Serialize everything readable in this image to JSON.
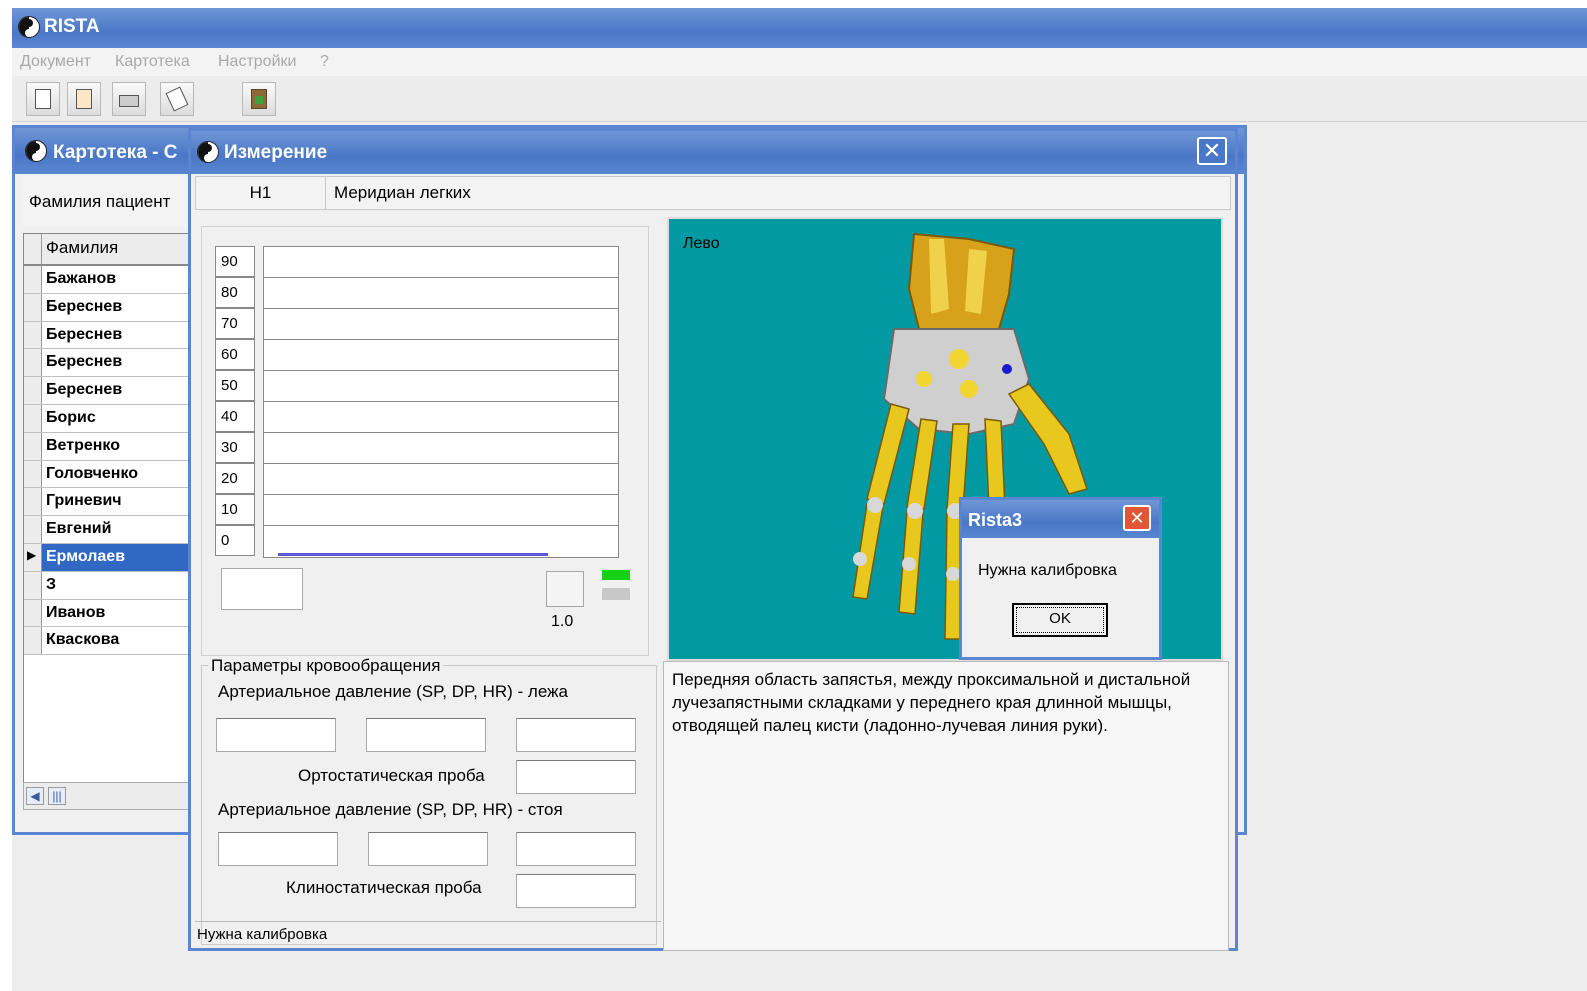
{
  "app": {
    "title": "RISTA"
  },
  "menu": [
    "Документ",
    "Картотека",
    "Настройки",
    "?"
  ],
  "toolbar": {
    "buttons": [
      "new-document-icon",
      "open-document-icon",
      "print-icon",
      "copy-document-icon",
      "exit-icon"
    ]
  },
  "kartoteka": {
    "title": "Картотека - С",
    "filter_label": "Фамилия пациент",
    "column_header": "Фамилия",
    "patients": [
      "Бажанов",
      "Береснев",
      "Береснев",
      "Береснев",
      "Береснев",
      "Борис",
      "Ветренко",
      "Головченко",
      "Гриневич",
      "Евгений",
      "Ермолаев",
      "З",
      "Иванов",
      "Кваскова"
    ],
    "selected": "Ермолаев"
  },
  "measurement": {
    "title": "Измерение",
    "meridian_code": "H1",
    "meridian_name": "Меридиан легких",
    "scale": [
      "90",
      "80",
      "70",
      "60",
      "50",
      "40",
      "30",
      "20",
      "10",
      "0"
    ],
    "coefficient": "1.0",
    "circulation": {
      "legend": "Параметры кровообращения",
      "lying_label": "Артериальное давление (SP, DP, HR) - лежа",
      "ortho_label": "Ортостатическая проба",
      "standing_label": "Артериальное давление (SP, DP, HR) - стоя",
      "clino_label": "Клиностатическая проба"
    },
    "side_label": "Лево",
    "description": "Передняя область запястья, между проксимальной и дистальной лучезапястными складками у переднего края длинной мышцы, отводящей палец кисти (ладонно-лучевая линия руки).",
    "status": "Нужна калибровка"
  },
  "dialog": {
    "title": "Rista3",
    "message": "Нужна калибровка",
    "ok_label": "OK"
  },
  "colors": {
    "titlebar": "#4a77c7",
    "selection": "#3168c4",
    "hand_bg": "#029aa2",
    "led_green": "#19d019"
  }
}
